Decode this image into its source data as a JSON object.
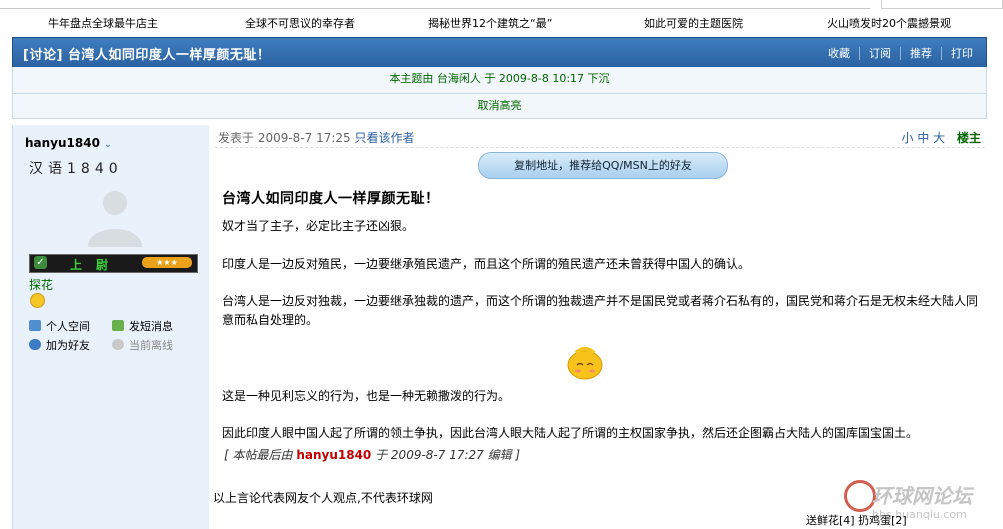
{
  "top_links": [
    "牛年盘点全球最牛店主",
    "全球不可思议的幸存者",
    "揭秘世界12个建筑之“最”",
    "如此可爱的主题医院",
    "火山喷发时20个震撼景观"
  ],
  "thread": {
    "title": "[讨论] 台湾人如同印度人一样厚颜无耻！",
    "actions": [
      "收藏",
      "订阅",
      "推荐",
      "打印"
    ],
    "bump_info": "本主题由 台海闲人 于 2009-8-8 10:17 下沉",
    "cancel_highlight": "取消高亮"
  },
  "author": {
    "name": "hanyu1840",
    "title": "汉语1840",
    "rank": "上尉",
    "flower": "探花",
    "links": [
      "个人空间",
      "发短消息",
      "加为好友",
      "当前离线"
    ]
  },
  "post": {
    "meta_posted": "发表于 2009-8-7 17:25",
    "meta_only_author": "只看该作者",
    "font_sizes": "小 中 大",
    "floor": "楼主",
    "copy_button": "复制地址，推荐给QQ/MSN上的好友",
    "title": "台湾人如同印度人一样厚颜无耻！",
    "paragraphs": [
      "奴才当了主子，必定比主子还凶狠。",
      "印度人是一边反对殖民，一边要继承殖民遗产，而且这个所谓的殖民遗产还未曾获得中国人的确认。",
      "台湾人是一边反对独裁，一边要继承独裁的遗产，而这个所谓的独裁遗产并不是国民党或者蒋介石私有的，国民党和蒋介石是无权未经大陆人同意而私自处理的。",
      "这是一种见利忘义的行为，也是一种无赖撒泼的行为。",
      "因此印度人眼中国人起了所谓的领土争执，因此台湾人眼大陆人起了所谓的主权国家争执，然后还企图霸占大陆人的国库国宝国土。"
    ],
    "edit_prefix": "[ 本帖最后由",
    "edit_user": "hanyu1840",
    "edit_suffix": "于 2009-8-7 17:27 编辑 ]",
    "disclaimer": "以上言论代表网友个人观点,不代表环球网",
    "bottom_links": "送鲜花[4]  扔鸡蛋[2]"
  },
  "watermark": {
    "name": "环球网论坛",
    "url": "bbs.huanqiu.com"
  },
  "colors": {
    "titlebar": "#2b62a3",
    "info_text": "#006600",
    "author_bg": "#e9f2fa",
    "edit_user": "#c00000"
  }
}
